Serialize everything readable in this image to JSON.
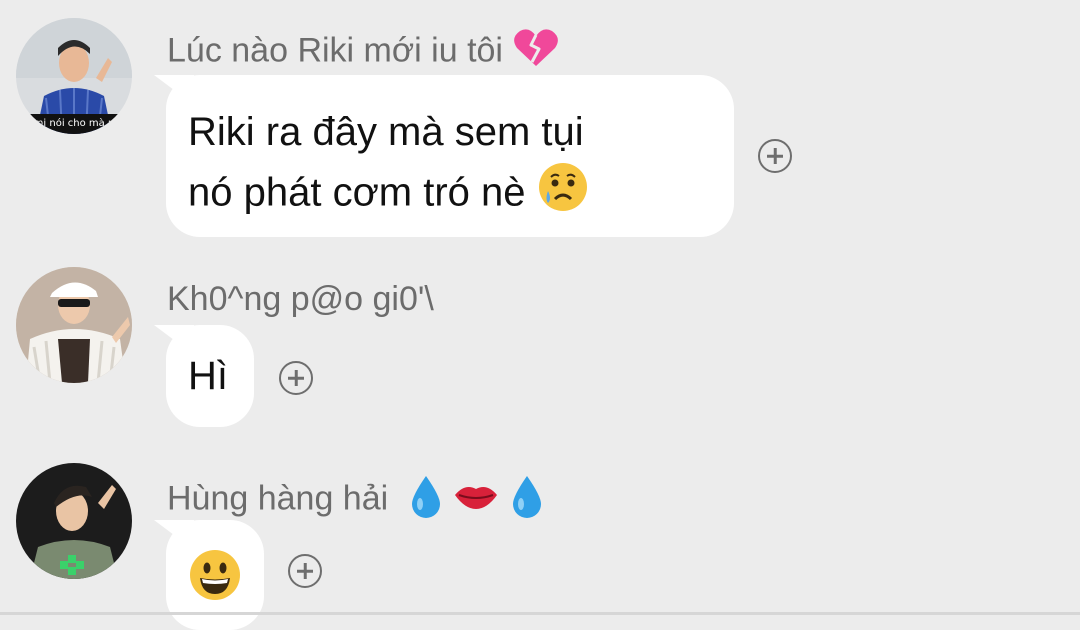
{
  "messages": [
    {
      "sender": "Lúc nào Riki mới iu tôi",
      "sender_emoji": "broken-heart-icon",
      "text_lines": [
        "Riki ra đây mà sem tụi",
        "nó phát cơm tró nè"
      ],
      "text_emoji": "crying-face-icon",
      "avatar_caption": "mi nói cho mà n"
    },
    {
      "sender": "Kh0^ng p@o gi0'\\",
      "text": "Hì"
    },
    {
      "sender": "Hùng hàng hải",
      "sender_emojis": [
        "droplet-icon",
        "lips-icon",
        "droplet-icon"
      ],
      "text_emoji": "grinning-face-icon"
    }
  ],
  "colors": {
    "background": "#ececec",
    "bubble": "#ffffff",
    "sender_text": "#6c6c6c",
    "message_text": "#111111",
    "icon_gray": "#6e6e6e"
  }
}
